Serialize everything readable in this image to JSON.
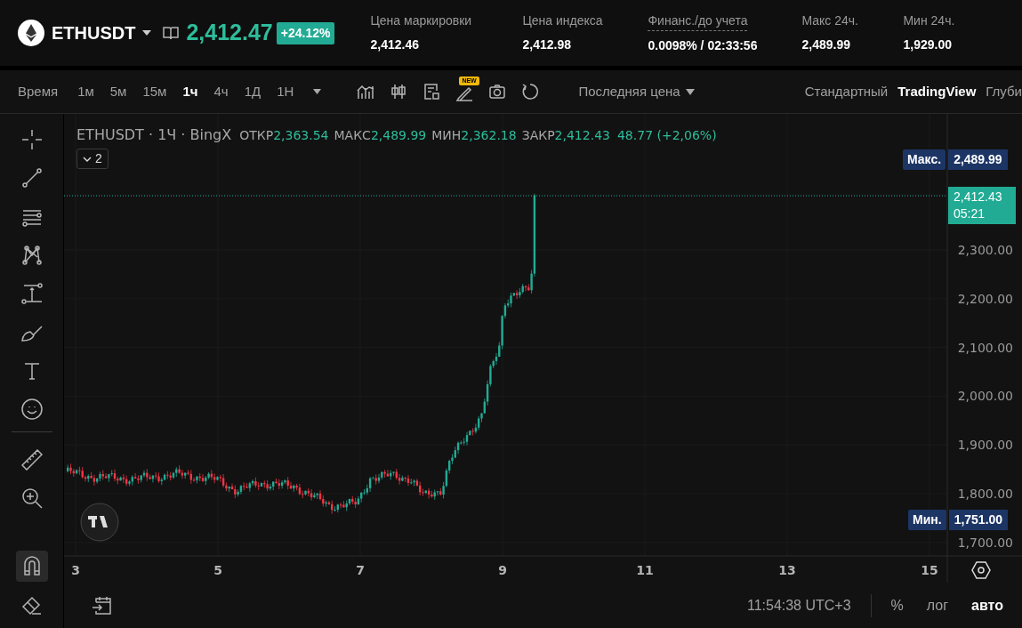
{
  "header": {
    "symbol": "ETHUSDT",
    "price": "2,412.47",
    "change": "+24.12%",
    "stats": [
      {
        "label": "Цена маркировки",
        "value": "2,412.46",
        "underlined": false
      },
      {
        "label": "Цена индекса",
        "value": "2,412.98",
        "underlined": false
      },
      {
        "label": "Финанс./до учета",
        "value": "0.0098% / 02:33:56",
        "underlined": true
      },
      {
        "label": "Макс 24ч.",
        "value": "2,489.99",
        "underlined": false
      },
      {
        "label": "Мин 24ч.",
        "value": "1,929.00",
        "underlined": false
      }
    ]
  },
  "toolbar": {
    "time_label": "Время",
    "intervals": [
      {
        "label": "1м",
        "selected": false
      },
      {
        "label": "5м",
        "selected": false
      },
      {
        "label": "15м",
        "selected": false
      },
      {
        "label": "1ч",
        "selected": true
      },
      {
        "label": "4ч",
        "selected": false
      },
      {
        "label": "1Д",
        "selected": false
      },
      {
        "label": "1Н",
        "selected": false
      }
    ],
    "new_badge": "NEW",
    "price_type": "Последняя цена",
    "views": [
      {
        "label": "Стандартный",
        "selected": false
      },
      {
        "label": "TradingView",
        "selected": true
      },
      {
        "label": "Глуби",
        "selected": false
      }
    ]
  },
  "tools": [
    {
      "selected": false
    },
    {
      "selected": false
    },
    {
      "selected": false
    },
    {
      "selected": false
    },
    {
      "selected": false
    },
    {
      "selected": false
    },
    {
      "selected": false
    },
    {
      "selected": false
    },
    {
      "selected": false
    },
    {
      "selected": false
    },
    {
      "selected": true
    },
    {
      "selected": false
    }
  ],
  "legend": {
    "title": "ETHUSDT · 1Ч · BingX",
    "fields": [
      {
        "label": "ОТКР",
        "value": "2,363.54"
      },
      {
        "label": "МАКС",
        "value": "2,489.99"
      },
      {
        "label": "МИН",
        "value": "2,362.18"
      },
      {
        "label": "ЗАКР",
        "value": "2,412.43"
      }
    ],
    "change": "48.77 (+2,06%)",
    "indicators_count": "2"
  },
  "price_axis": {
    "ticks": [
      "2,300.00",
      "2,200.00",
      "2,100.00",
      "2,000.00",
      "1,900.00",
      "1,800.00",
      "1,700.00"
    ],
    "max": {
      "label": "Макс.",
      "value": "2,489.99"
    },
    "last": {
      "value": "2,412.43",
      "countdown": "05:21"
    },
    "min": {
      "label": "Мин.",
      "value": "1,751.00"
    }
  },
  "time_axis": {
    "ticks": [
      "3",
      "5",
      "7",
      "9",
      "11",
      "13",
      "15"
    ]
  },
  "status_bar": {
    "clock": "11:54:38 UTC+3",
    "scales": [
      {
        "label": "%",
        "selected": false
      },
      {
        "label": "лог",
        "selected": false
      },
      {
        "label": "авто",
        "selected": true
      }
    ]
  }
}
